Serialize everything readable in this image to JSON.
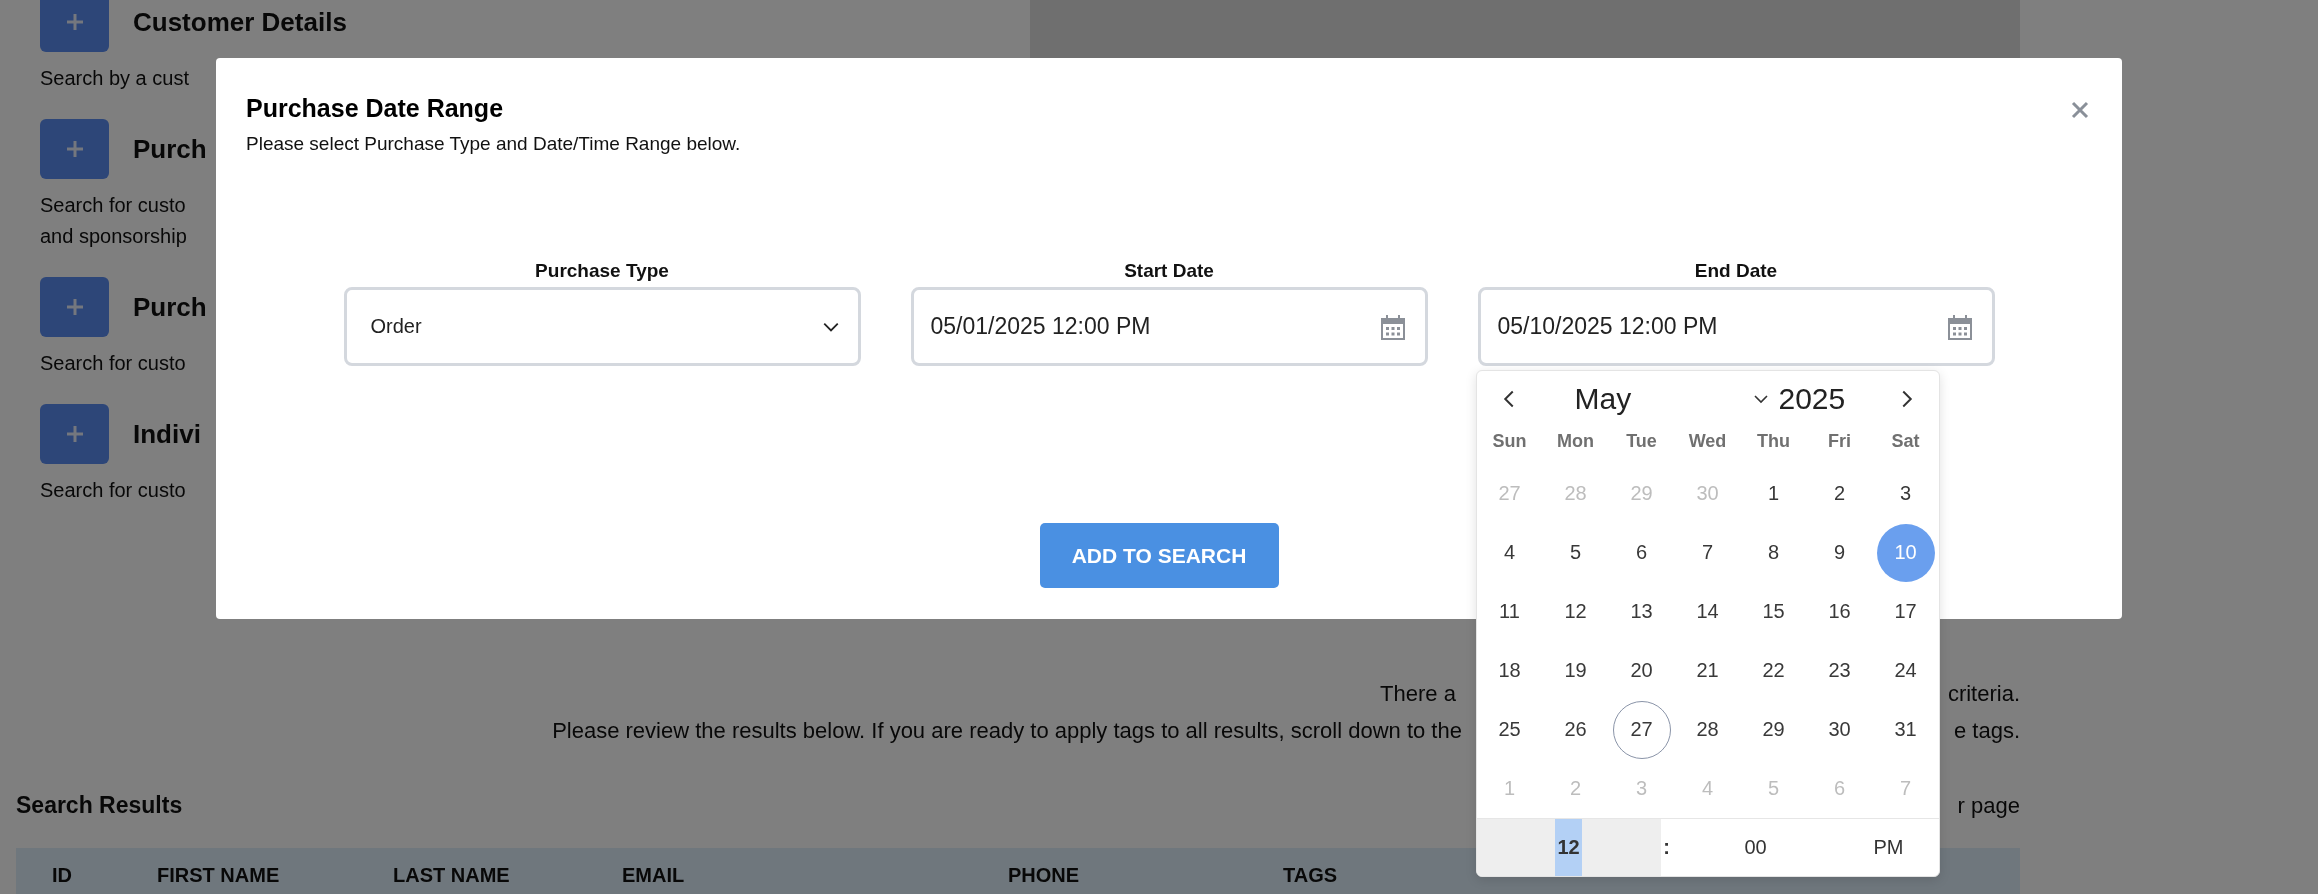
{
  "background": {
    "sections": [
      {
        "title": "Customer Details",
        "description": [
          "Search by a cust"
        ]
      },
      {
        "title": "Purch",
        "description": [
          "Search for custo",
          "and sponsorship"
        ]
      },
      {
        "title": "Purch",
        "description": [
          "Search for custo"
        ]
      },
      {
        "title": "Indivi",
        "description": [
          "Search for custo"
        ]
      }
    ],
    "result_message": [
      {
        "left": "There a",
        "right": "criteria."
      },
      {
        "left": "Please review the results below. If you are ready to apply tags to all results, scroll down to the",
        "right": "e tags."
      }
    ],
    "results_title": "Search Results",
    "per_page": "r page",
    "table_columns": [
      "ID",
      "FIRST NAME",
      "LAST NAME",
      "EMAIL",
      "PHONE",
      "TAGS"
    ]
  },
  "modal": {
    "title": "Purchase Date Range",
    "subtitle": "Please select Purchase Type and Date/Time Range below.",
    "fields": [
      {
        "kind": "select",
        "label": "Purchase Type",
        "value": "Order"
      },
      {
        "kind": "date",
        "label": "Start Date",
        "value": "05/01/2025 12:00 PM"
      },
      {
        "kind": "date",
        "label": "End Date",
        "value": "05/10/2025 12:00 PM"
      }
    ],
    "button": "ADD TO SEARCH",
    "calendar": {
      "month": "May",
      "year": "2025",
      "weekdays": [
        "Sun",
        "Mon",
        "Tue",
        "Wed",
        "Thu",
        "Fri",
        "Sat"
      ],
      "days": [
        {
          "day": "27",
          "in_month": false,
          "selected": false,
          "today": false
        },
        {
          "day": "28",
          "in_month": false,
          "selected": false,
          "today": false
        },
        {
          "day": "29",
          "in_month": false,
          "selected": false,
          "today": false
        },
        {
          "day": "30",
          "in_month": false,
          "selected": false,
          "today": false
        },
        {
          "day": "1",
          "in_month": true,
          "selected": false,
          "today": false
        },
        {
          "day": "2",
          "in_month": true,
          "selected": false,
          "today": false
        },
        {
          "day": "3",
          "in_month": true,
          "selected": false,
          "today": false
        },
        {
          "day": "4",
          "in_month": true,
          "selected": false,
          "today": false
        },
        {
          "day": "5",
          "in_month": true,
          "selected": false,
          "today": false
        },
        {
          "day": "6",
          "in_month": true,
          "selected": false,
          "today": false
        },
        {
          "day": "7",
          "in_month": true,
          "selected": false,
          "today": false
        },
        {
          "day": "8",
          "in_month": true,
          "selected": false,
          "today": false
        },
        {
          "day": "9",
          "in_month": true,
          "selected": false,
          "today": false
        },
        {
          "day": "10",
          "in_month": true,
          "selected": true,
          "today": false
        },
        {
          "day": "11",
          "in_month": true,
          "selected": false,
          "today": false
        },
        {
          "day": "12",
          "in_month": true,
          "selected": false,
          "today": false
        },
        {
          "day": "13",
          "in_month": true,
          "selected": false,
          "today": false
        },
        {
          "day": "14",
          "in_month": true,
          "selected": false,
          "today": false
        },
        {
          "day": "15",
          "in_month": true,
          "selected": false,
          "today": false
        },
        {
          "day": "16",
          "in_month": true,
          "selected": false,
          "today": false
        },
        {
          "day": "17",
          "in_month": true,
          "selected": false,
          "today": false
        },
        {
          "day": "18",
          "in_month": true,
          "selected": false,
          "today": false
        },
        {
          "day": "19",
          "in_month": true,
          "selected": false,
          "today": false
        },
        {
          "day": "20",
          "in_month": true,
          "selected": false,
          "today": false
        },
        {
          "day": "21",
          "in_month": true,
          "selected": false,
          "today": false
        },
        {
          "day": "22",
          "in_month": true,
          "selected": false,
          "today": false
        },
        {
          "day": "23",
          "in_month": true,
          "selected": false,
          "today": false
        },
        {
          "day": "24",
          "in_month": true,
          "selected": false,
          "today": false
        },
        {
          "day": "25",
          "in_month": true,
          "selected": false,
          "today": false
        },
        {
          "day": "26",
          "in_month": true,
          "selected": false,
          "today": false
        },
        {
          "day": "27",
          "in_month": true,
          "selected": false,
          "today": true
        },
        {
          "day": "28",
          "in_month": true,
          "selected": false,
          "today": false
        },
        {
          "day": "29",
          "in_month": true,
          "selected": false,
          "today": false
        },
        {
          "day": "30",
          "in_month": true,
          "selected": false,
          "today": false
        },
        {
          "day": "31",
          "in_month": true,
          "selected": false,
          "today": false
        },
        {
          "day": "1",
          "in_month": false,
          "selected": false,
          "today": false
        },
        {
          "day": "2",
          "in_month": false,
          "selected": false,
          "today": false
        },
        {
          "day": "3",
          "in_month": false,
          "selected": false,
          "today": false
        },
        {
          "day": "4",
          "in_month": false,
          "selected": false,
          "today": false
        },
        {
          "day": "5",
          "in_month": false,
          "selected": false,
          "today": false
        },
        {
          "day": "6",
          "in_month": false,
          "selected": false,
          "today": false
        },
        {
          "day": "7",
          "in_month": false,
          "selected": false,
          "today": false
        }
      ],
      "time": {
        "hour": {
          "value": "12",
          "selected": true
        },
        "separator": ":",
        "minute": {
          "value": "00",
          "selected": false
        },
        "period": "PM"
      }
    }
  }
}
